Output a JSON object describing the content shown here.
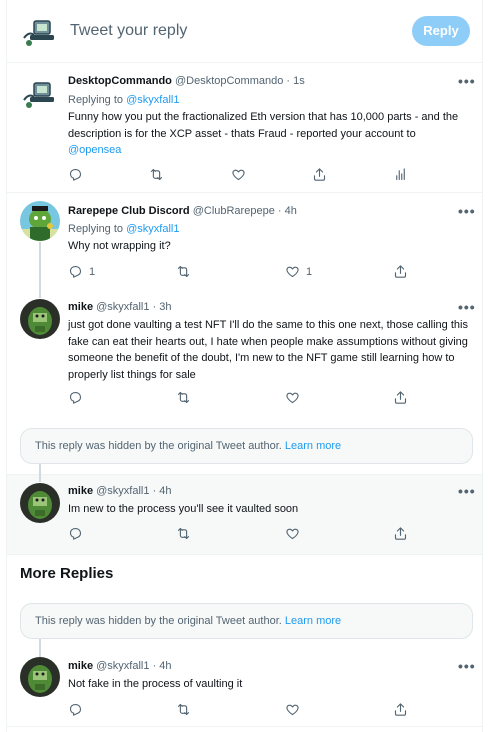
{
  "compose": {
    "placeholder": "Tweet your reply",
    "reply_label": "Reply"
  },
  "tweets": [
    {
      "name": "DesktopCommando",
      "handle": "@DesktopCommando",
      "time": "· 1s",
      "replying_prefix": "Replying to",
      "replying_to": "@skyxfall1",
      "text_main": "Funny how you put the fractionalized Eth version that has 10,000 parts - and the description is for the XCP asset - thats Fraud - reported your account to ",
      "text_link": "@opensea"
    },
    {
      "name": "Rarepepe Club Discord",
      "handle": "@ClubRarepepe",
      "time": "· 4h",
      "replying_prefix": "Replying to",
      "replying_to": "@skyxfall1",
      "text": "Why not wrapping it?",
      "reply_count": "1",
      "like_count": "1"
    },
    {
      "name": "mike",
      "handle": "@skyxfall1",
      "time": "· 3h",
      "text": "just got done vaulting a test NFT I'll do the same to this one next, those calling this fake can eat their hearts out, I hate when people make assumptions without giving someone the benefit of the doubt, I'm new to the NFT game still learning how to properly list things for sale"
    },
    {
      "name": "mike",
      "handle": "@skyxfall1",
      "time": "· 4h",
      "text": "Im new to the process you'll see it vaulted soon"
    },
    {
      "name": "mike",
      "handle": "@skyxfall1",
      "time": "· 4h",
      "text": "Not fake in the process of vaulting it"
    }
  ],
  "hidden_reply": {
    "text": "This reply was hidden by the original Tweet author.",
    "link": "Learn more"
  },
  "more_replies_title": "More Replies",
  "more_icon_text": "•••",
  "colors": {
    "accent": "#1d9bf0",
    "reply_button": "#8ecdf8",
    "muted": "#536471",
    "highlight_bg": "#f7f9f9"
  },
  "icons": [
    "reply-icon",
    "retweet-icon",
    "like-icon",
    "share-icon",
    "analytics-icon",
    "more-icon"
  ]
}
